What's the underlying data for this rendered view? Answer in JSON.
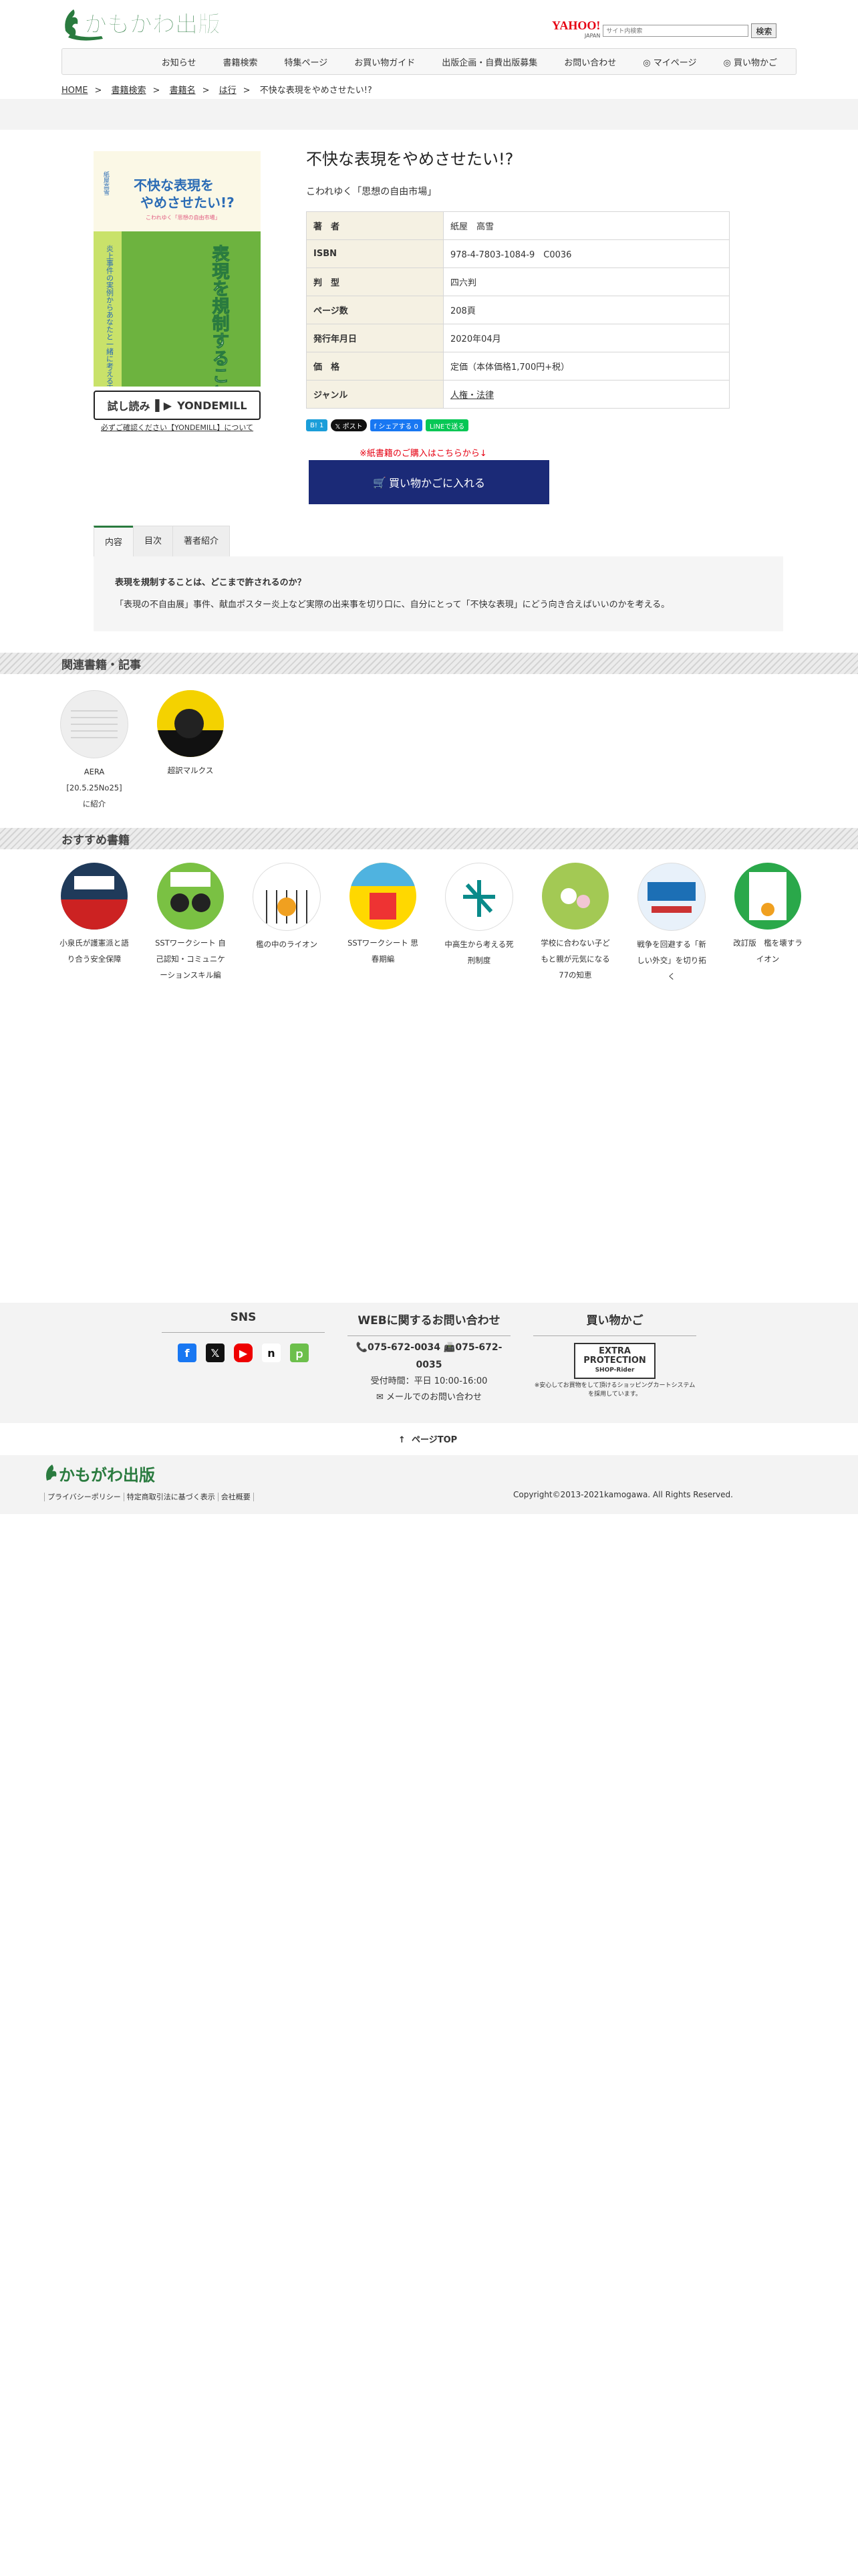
{
  "header": {
    "logo_text": "かもがわ出版",
    "yahoo_brand": "YAHOO!",
    "yahoo_sub": "JAPAN",
    "search_placeholder": "サイト内検索",
    "search_button": "検索"
  },
  "nav": [
    "お知らせ",
    "書籍検索",
    "特集ページ",
    "お買い物ガイド",
    "出版企画・自費出版募集",
    "お問い合わせ",
    "マイページ",
    "買い物かご"
  ],
  "breadcrumb": [
    "HOME",
    "書籍検索",
    "書籍名",
    "は行",
    "不快な表現をやめさせたい!?"
  ],
  "book": {
    "title": "不快な表現をやめさせたい!?",
    "subtitle": "こわれゆく「思想の自由市場」",
    "cover_series": "紙屋高雪",
    "cover_title_top": "不快な表現を",
    "cover_title_top2": "やめさせたい!?",
    "cover_title_top3": "こわれゆく「思想の自由市場」",
    "cover_main": "表現を規制することはどこまで許されるのか?",
    "cover_side": "炎上事件の実例からあなたと一緒に考える表現の自由",
    "specs": [
      {
        "label": "著　者",
        "value": "紙屋　高雪"
      },
      {
        "label": "ISBN",
        "value": "978-4-7803-1084-9　C0036"
      },
      {
        "label": "判　型",
        "value": "四六判"
      },
      {
        "label": "ページ数",
        "value": "208頁"
      },
      {
        "label": "発行年月日",
        "value": "2020年04月"
      },
      {
        "label": "価　格",
        "value": "定価（本体価格1,700円+税）"
      },
      {
        "label": "ジャンル",
        "value": "人権・法律"
      }
    ],
    "read_button": "試し読み",
    "read_brand": "YONDEMILL",
    "read_note": "必ずご確認ください【YONDEMILL】について",
    "share": [
      "B! 1",
      "𝕏 ポスト",
      "f シェアする 0",
      "LINEで送る"
    ],
    "paper_link": "※紙書籍のご購入はこちらから↓",
    "cart_button": "買い物かごに入れる"
  },
  "tabs": [
    "内容",
    "目次",
    "著者紹介"
  ],
  "tab_content": {
    "heading": "表現を規制することは、どこまで許されるのか？",
    "body": "「表現の不自由展」事件、献血ポスター炎上など実際の出来事を切り口に、自分にとって「不快な表現」にどう向き合えばいいのかを考える。"
  },
  "related": {
    "title": "関連書籍・記事",
    "items": [
      {
        "label": "AERA\n[20.5.25No25]\nに紹介"
      },
      {
        "label": "超訳マルクス"
      }
    ]
  },
  "recommended": {
    "title": "おすすめ書籍",
    "items": [
      {
        "label": "小泉氏が護憲派と語り合う安全保障"
      },
      {
        "label": "SSTワークシート 自己認知・コミュニケーションスキル編"
      },
      {
        "label": "檻の中のライオン"
      },
      {
        "label": "SSTワークシート 思春期編"
      },
      {
        "label": "中高生から考える死刑制度"
      },
      {
        "label": "学校に合わない子どもと親が元気になる77の知恵"
      },
      {
        "label": "戦争を回避する「新しい外交」を切り拓く"
      },
      {
        "label": "改訂版　檻を壊すライオン"
      }
    ]
  },
  "footer": {
    "sns_title": "SNS",
    "contact_title": "WEBに関するお問い合わせ",
    "phone": "075-672-0034",
    "fax": "075-672-0035",
    "hours": "受付時間：平日 10:00-16:00",
    "mail": "メールでのお問い合わせ",
    "cart_title": "買い物かご",
    "badge_line1": "EXTRA",
    "badge_line2": "PROTECTION",
    "badge_line3": "SHOP-Rider",
    "badge_note": "※安心してお買物をして頂けるショッピングカートシステムを採用しています。",
    "pagetop": "ページTOP",
    "links": [
      "プライバシーポリシー",
      "特定商取引法に基づく表示",
      "会社概要"
    ],
    "copyright": "Copyright©2013-2021kamogawa. All Rights Reserved."
  },
  "colors": {
    "brand_green": "#2a7b3f",
    "cart_navy": "#1b2a77",
    "accent_red": "#e60012"
  }
}
